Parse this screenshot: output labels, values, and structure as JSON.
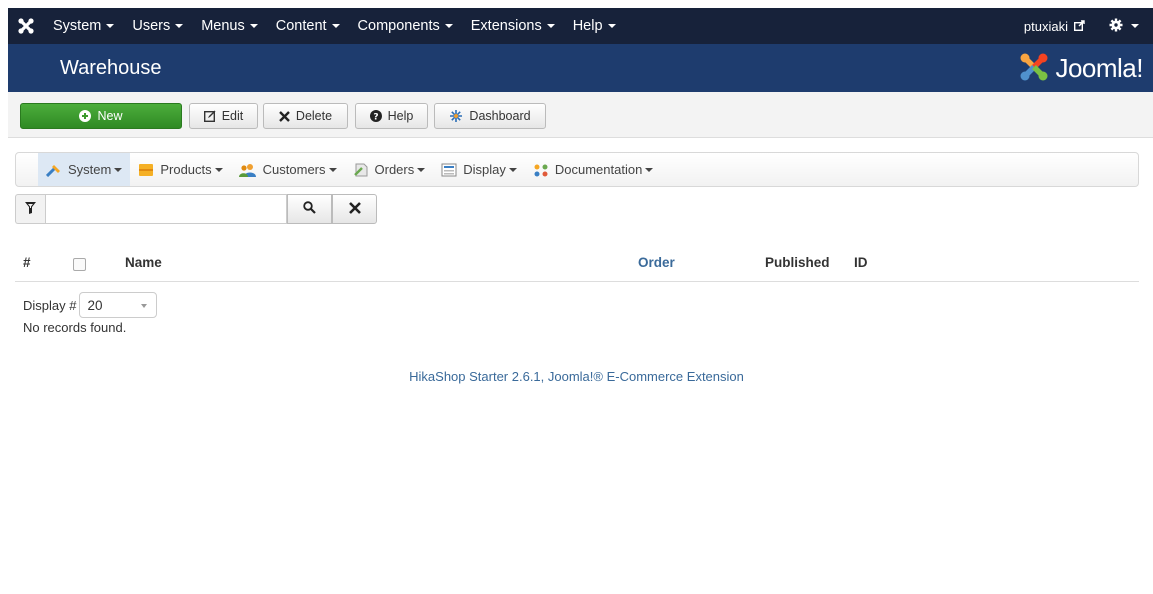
{
  "topnav": {
    "items": [
      {
        "label": "System"
      },
      {
        "label": "Users"
      },
      {
        "label": "Menus"
      },
      {
        "label": "Content"
      },
      {
        "label": "Components"
      },
      {
        "label": "Extensions"
      },
      {
        "label": "Help"
      }
    ],
    "username": "ptuxiaki"
  },
  "header": {
    "title": "Warehouse",
    "brand": "Joomla!"
  },
  "toolbar": {
    "new_label": "New",
    "edit_label": "Edit",
    "delete_label": "Delete",
    "help_label": "Help",
    "dashboard_label": "Dashboard"
  },
  "hikamenu": {
    "items": [
      {
        "label": "System"
      },
      {
        "label": "Products"
      },
      {
        "label": "Customers"
      },
      {
        "label": "Orders"
      },
      {
        "label": "Display"
      },
      {
        "label": "Documentation"
      }
    ]
  },
  "search": {
    "value": "",
    "placeholder": ""
  },
  "table": {
    "columns": {
      "num": "#",
      "name": "Name",
      "order": "Order",
      "published": "Published",
      "id": "ID"
    }
  },
  "pagination": {
    "display_label": "Display #",
    "limit": "20"
  },
  "messages": {
    "no_records": "No records found."
  },
  "footer": {
    "text": "HikaShop Starter 2.6.1, Joomla!® E-Commerce Extension"
  },
  "colors": {
    "topnav_bg": "#17223a",
    "header_bg": "#1e3c6e",
    "new_button": "#3c9a2e",
    "link": "#3a6a9a"
  }
}
